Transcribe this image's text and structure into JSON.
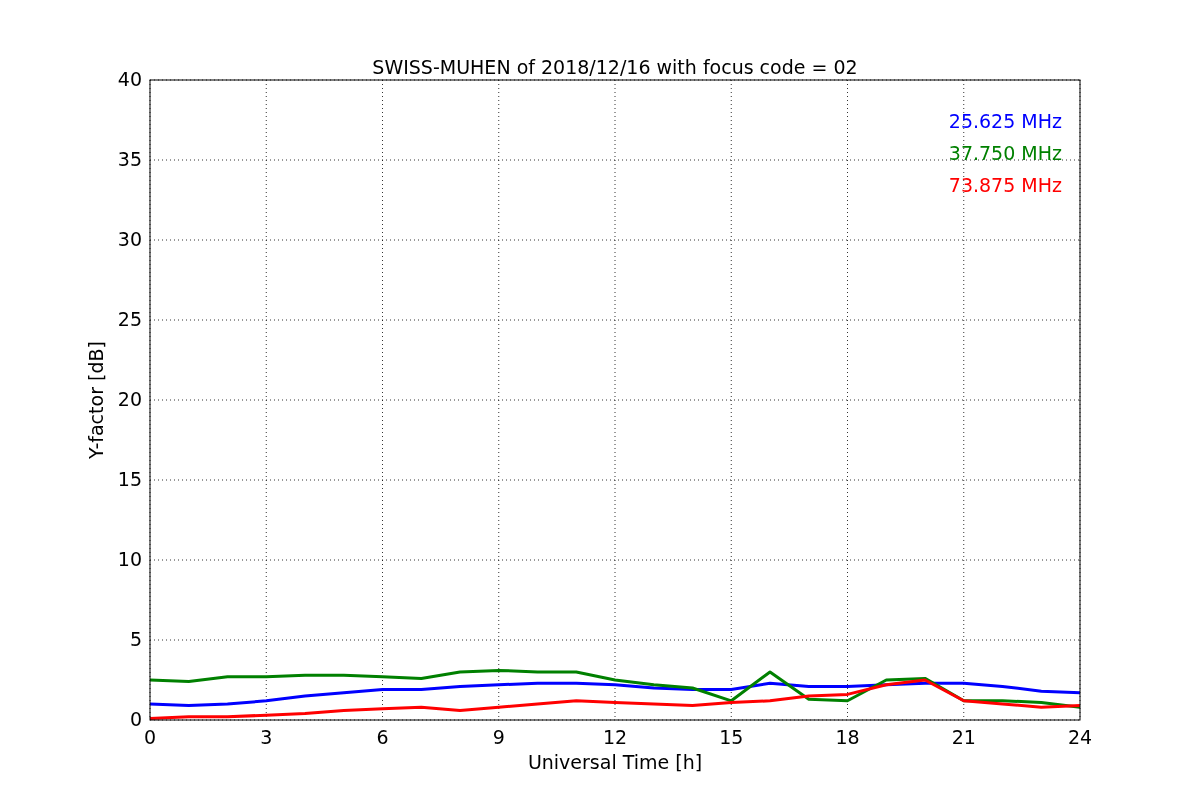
{
  "figure": {
    "chart_data": {
      "type": "line",
      "title": "SWISS-MUHEN of 2018/12/16 with focus code = 02",
      "xlabel": "Universal Time [h]",
      "ylabel": "Y-factor [dB]",
      "x": [
        0,
        1,
        2,
        3,
        4,
        5,
        6,
        7,
        8,
        9,
        10,
        11,
        12,
        13,
        14,
        15,
        16,
        17,
        18,
        19,
        20,
        21,
        22,
        23,
        24
      ],
      "series": [
        {
          "name": "25.625 MHz",
          "color": "#0000ff",
          "values": [
            1.0,
            0.9,
            1.0,
            1.2,
            1.5,
            1.7,
            1.9,
            1.9,
            2.1,
            2.2,
            2.3,
            2.3,
            2.2,
            2.0,
            1.9,
            1.9,
            2.3,
            2.1,
            2.1,
            2.2,
            2.3,
            2.3,
            2.1,
            1.8,
            1.7
          ]
        },
        {
          "name": "37.750 MHz",
          "color": "#008000",
          "values": [
            2.5,
            2.4,
            2.7,
            2.7,
            2.8,
            2.8,
            2.7,
            2.6,
            3.0,
            3.1,
            3.0,
            3.0,
            2.5,
            2.2,
            2.0,
            1.2,
            3.0,
            1.3,
            1.2,
            2.5,
            2.6,
            1.2,
            1.2,
            1.1,
            0.8
          ]
        },
        {
          "name": "73.875 MHz",
          "color": "#ff0000",
          "values": [
            0.1,
            0.2,
            0.2,
            0.3,
            0.4,
            0.6,
            0.7,
            0.8,
            0.6,
            0.8,
            1.0,
            1.2,
            1.1,
            1.0,
            0.9,
            1.1,
            1.2,
            1.5,
            1.6,
            2.2,
            2.5,
            1.2,
            1.0,
            0.8,
            0.9
          ]
        }
      ],
      "xlim": [
        0,
        24
      ],
      "ylim": [
        0,
        40
      ],
      "xticks": [
        0,
        3,
        6,
        9,
        12,
        15,
        18,
        21,
        24
      ],
      "yticks": [
        0,
        5,
        10,
        15,
        20,
        25,
        30,
        35,
        40
      ],
      "grid": true
    }
  }
}
